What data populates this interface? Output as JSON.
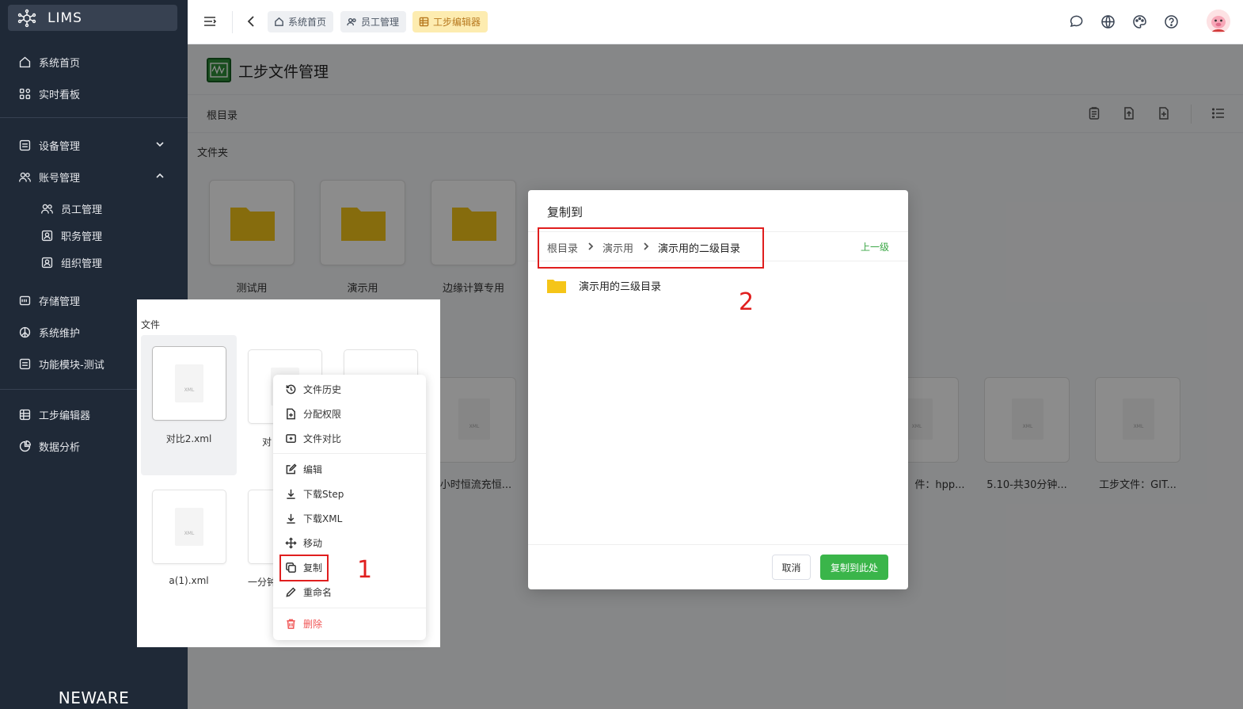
{
  "app": {
    "logo_text": "LIMS",
    "brand": "NEWARE"
  },
  "sidebar": {
    "items": [
      {
        "label": "系统首页"
      },
      {
        "label": "实时看板"
      },
      {
        "label": "设备管理"
      },
      {
        "label": "账号管理"
      },
      {
        "label": "员工管理"
      },
      {
        "label": "职务管理"
      },
      {
        "label": "组织管理"
      },
      {
        "label": "存储管理"
      },
      {
        "label": "系统维护"
      },
      {
        "label": "功能模块-测试"
      },
      {
        "label": "工步编辑器"
      },
      {
        "label": "数据分析"
      }
    ]
  },
  "tabs": [
    {
      "label": "系统首页"
    },
    {
      "label": "员工管理"
    },
    {
      "label": "工步编辑器"
    }
  ],
  "page": {
    "title": "工步文件管理",
    "root_crumb": "根目录",
    "folders_label": "文件夹",
    "folders": [
      {
        "name": "测试用"
      },
      {
        "name": "演示用"
      },
      {
        "name": "边缘计算专用"
      }
    ],
    "bg_files": [
      {
        "name": "小时恒流充恒..."
      },
      {
        "name": "件：hpp..."
      },
      {
        "name": "5.10-共30分钟..."
      },
      {
        "name": "工步文件：GIT..."
      }
    ]
  },
  "inset": {
    "files_label": "文件",
    "files": [
      {
        "name": "对比2.xml"
      },
      {
        "name": "对"
      },
      {
        "name": "a(1).xml"
      },
      {
        "name": "一分钟"
      }
    ],
    "doc_tag": "XML"
  },
  "context_menu": {
    "items": [
      {
        "label": "文件历史"
      },
      {
        "label": "分配权限"
      },
      {
        "label": "文件对比"
      },
      {
        "label": "编辑"
      },
      {
        "label": "下载Step"
      },
      {
        "label": "下载XML"
      },
      {
        "label": "移动"
      },
      {
        "label": "复制"
      },
      {
        "label": "重命名"
      },
      {
        "label": "删除"
      }
    ]
  },
  "callouts": {
    "one": "1",
    "two": "2"
  },
  "dialog": {
    "title": "复制到",
    "path": [
      "根目录",
      "演示用",
      "演示用的二级目录"
    ],
    "up_label": "上一级",
    "folders": [
      {
        "name": "演示用的三级目录"
      }
    ],
    "cancel_label": "取消",
    "confirm_label": "复制到此处"
  },
  "colors": {
    "sidebar_bg": "#1f2937",
    "accent_green": "#3ab54a",
    "folder_yellow": "#f5c518",
    "highlight_red": "#e01e1e",
    "active_tab_bg": "#fdecb0"
  }
}
